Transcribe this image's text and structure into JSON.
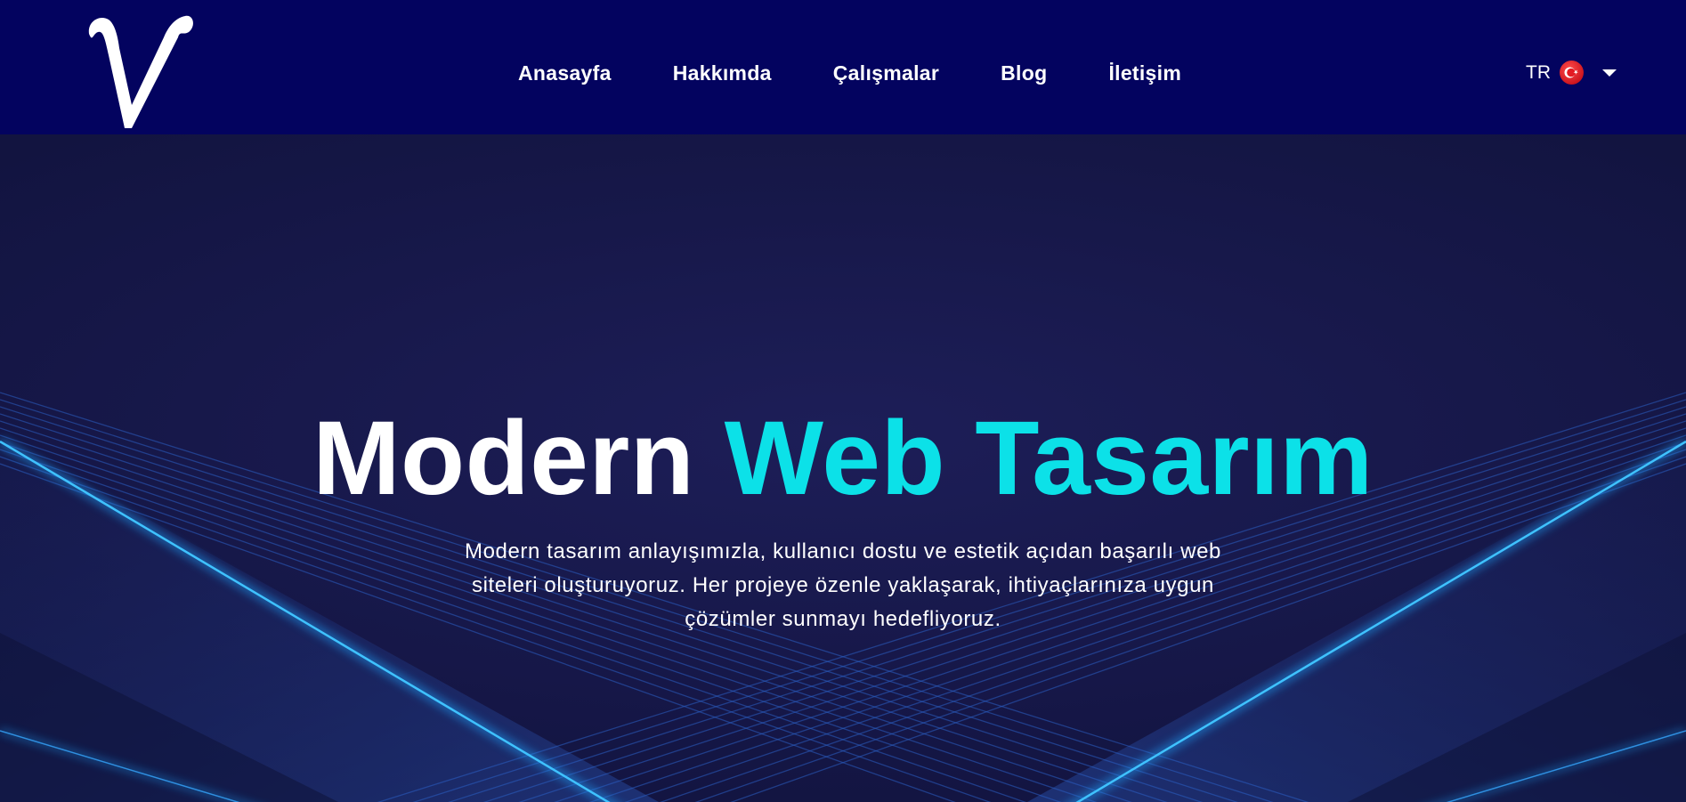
{
  "colors": {
    "navbar_bg": "#03035f",
    "hero_bg": "#17184a",
    "accent": "#0ce1e8",
    "text": "#ffffff",
    "glow": "#1aa6ff"
  },
  "logo": {
    "letter": "V",
    "icon": "v-logo-icon"
  },
  "nav": {
    "items": [
      {
        "label": "Anasayfa"
      },
      {
        "label": "Hakkımda"
      },
      {
        "label": "Çalışmalar"
      },
      {
        "label": "Blog"
      },
      {
        "label": "İletişim"
      }
    ]
  },
  "language": {
    "code": "TR",
    "flag_icon": "turkey-flag-icon",
    "dropdown_icon": "caret-down-icon"
  },
  "hero": {
    "title_plain": "Modern",
    "title_accent": "Web Tasarım",
    "description": "Modern tasarım anlayışımızla, kullanıcı dostu ve estetik açıdan başarılı web siteleri oluşturuyoruz. Her projeye özenle yaklaşarak, ihtiyaçlarınıza uygun çözümler sunmayı hedefliyoruz."
  }
}
